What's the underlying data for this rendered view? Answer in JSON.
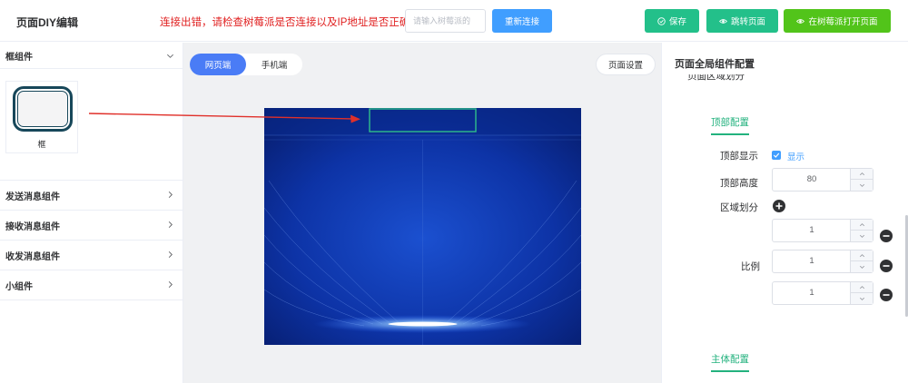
{
  "header": {
    "title": "页面DIY编辑",
    "error_message": "连接出错，请检查树莓派是否连接以及IP地址是否正确!",
    "host_input": {
      "placeholder": "请输入树莓派的",
      "value": ""
    },
    "reconnect_label": "重新连接",
    "save_label": "保存",
    "jump_label": "跳转页面",
    "open_on_pi_label": "在树莓派打开页面"
  },
  "sidebar": {
    "frame_group": {
      "label": "框组件",
      "expanded": true,
      "items": [
        {
          "label": "框"
        }
      ]
    },
    "groups": [
      {
        "label": "发送消息组件"
      },
      {
        "label": "接收消息组件"
      },
      {
        "label": "收发消息组件"
      },
      {
        "label": "小组件"
      }
    ]
  },
  "canvas": {
    "tabs": [
      {
        "label": "网页端",
        "active": true
      },
      {
        "label": "手机端",
        "active": false
      }
    ],
    "page_settings_label": "页面设置"
  },
  "right_panel": {
    "title": "页面全局组件配置",
    "cut_off_label": "页面区域划分",
    "top_section": {
      "tab_label": "顶部配置",
      "top_display": {
        "label": "顶部显示",
        "checkbox_label": "显示",
        "checked": true
      },
      "top_height": {
        "label": "顶部高度",
        "value": "80"
      },
      "region_split": {
        "label": "区域划分"
      },
      "ratio": {
        "label": "比例",
        "values": [
          "1",
          "1",
          "1"
        ]
      }
    },
    "main_section": {
      "tab_label": "主体配置"
    }
  },
  "colors": {
    "primary_blue": "#409eff",
    "tab_blue": "#4a7cf6",
    "save_green": "#23c08a",
    "open_green": "#52c41a",
    "accent_green": "#23b27e",
    "error_red": "#e02020",
    "arrow_red": "#e0302a",
    "preview_navy": "#0a2a8c"
  },
  "icons": {
    "save": "check-circle-icon",
    "jump": "eye-icon",
    "open_on_pi": "eye-icon",
    "add_region": "plus-circle-icon",
    "remove_ratio": "minus-circle-icon",
    "expand": "chevron-down-icon",
    "collapsed": "chevron-right-icon"
  }
}
